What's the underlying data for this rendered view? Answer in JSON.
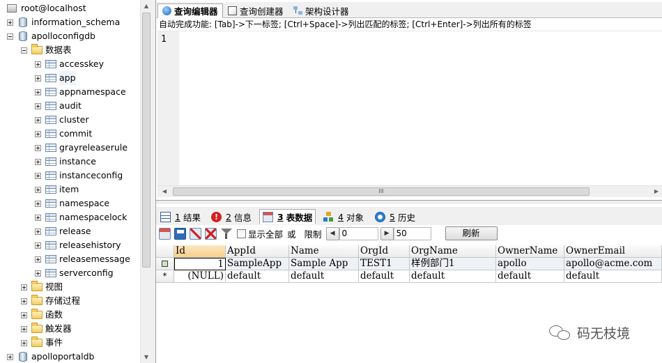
{
  "tree": {
    "items": [
      {
        "label": "root@localhost",
        "icon": "server-icon",
        "expander": "none"
      },
      {
        "label": "information_schema",
        "icon": "database-icon",
        "expander": "plus"
      },
      {
        "label": "apolloconfigdb",
        "icon": "database-icon",
        "expander": "minus"
      },
      {
        "label": "数据表",
        "icon": "folder-icon",
        "expander": "minus"
      },
      {
        "label": "accesskey",
        "icon": "table-icon",
        "expander": "plus"
      },
      {
        "label": "app",
        "icon": "table-icon",
        "expander": "plus",
        "selected": true
      },
      {
        "label": "appnamespace",
        "icon": "table-icon",
        "expander": "plus"
      },
      {
        "label": "audit",
        "icon": "table-icon",
        "expander": "plus"
      },
      {
        "label": "cluster",
        "icon": "table-icon",
        "expander": "plus"
      },
      {
        "label": "commit",
        "icon": "table-icon",
        "expander": "plus"
      },
      {
        "label": "grayreleaserule",
        "icon": "table-icon",
        "expander": "plus"
      },
      {
        "label": "instance",
        "icon": "table-icon",
        "expander": "plus"
      },
      {
        "label": "instanceconfig",
        "icon": "table-icon",
        "expander": "plus"
      },
      {
        "label": "item",
        "icon": "table-icon",
        "expander": "plus"
      },
      {
        "label": "namespace",
        "icon": "table-icon",
        "expander": "plus"
      },
      {
        "label": "namespacelock",
        "icon": "table-icon",
        "expander": "plus"
      },
      {
        "label": "release",
        "icon": "table-icon",
        "expander": "plus"
      },
      {
        "label": "releasehistory",
        "icon": "table-icon",
        "expander": "plus"
      },
      {
        "label": "releasemessage",
        "icon": "table-icon",
        "expander": "plus"
      },
      {
        "label": "serverconfig",
        "icon": "table-icon",
        "expander": "plus"
      },
      {
        "label": "视图",
        "icon": "folder-icon",
        "expander": "plus"
      },
      {
        "label": "存储过程",
        "icon": "folder-icon",
        "expander": "plus"
      },
      {
        "label": "函数",
        "icon": "folder-icon",
        "expander": "plus"
      },
      {
        "label": "触发器",
        "icon": "folder-icon",
        "expander": "plus"
      },
      {
        "label": "事件",
        "icon": "folder-icon",
        "expander": "plus"
      },
      {
        "label": "apolloportaldb",
        "icon": "database-icon",
        "expander": "plus"
      }
    ]
  },
  "query_tabs": [
    {
      "label": "查询编辑器",
      "icon": "query-editor-icon",
      "active": true
    },
    {
      "label": "查询创建器",
      "icon": "query-builder-icon",
      "active": false
    },
    {
      "label": "架构设计器",
      "icon": "schema-designer-icon",
      "active": false
    }
  ],
  "editor": {
    "hint": "自动完成功能: [Tab]->下一标签; [Ctrl+Space]->列出匹配的标签; [Ctrl+Enter]->列出所有的标签",
    "line_number": "1",
    "hscroll_grip": "III"
  },
  "result_tabs": [
    {
      "num": "1",
      "label": "结果",
      "icon": "result-icon",
      "active": false
    },
    {
      "num": "2",
      "label": "信息",
      "icon": "info-icon",
      "active": false
    },
    {
      "num": "3",
      "label": "表数据",
      "icon": "table-data-icon",
      "active": true
    },
    {
      "num": "4",
      "label": "对象",
      "icon": "objects-icon",
      "active": false
    },
    {
      "num": "5",
      "label": "历史",
      "icon": "history-icon",
      "active": false
    }
  ],
  "toolbar": {
    "show_all_label": "显示全部",
    "or_label": "或",
    "limit_label": "限制",
    "offset_value": "0",
    "count_value": "50",
    "refresh_label": "刷新",
    "prev_glyph": "◀",
    "next_glyph": "▶"
  },
  "grid": {
    "columns": [
      "Id",
      "AppId",
      "Name",
      "OrgId",
      "OrgName",
      "OwnerName",
      "OwnerEmail"
    ],
    "rows": [
      {
        "indicator": "",
        "cells": [
          "1",
          "SampleApp",
          "Sample App",
          "TEST1",
          "样例部门1",
          "apollo",
          "apollo@acme.com"
        ]
      },
      {
        "indicator": "*",
        "cells": [
          "(NULL)",
          "default",
          "default",
          "default",
          "default",
          "default",
          "default"
        ]
      }
    ]
  },
  "watermark": "码无枝境",
  "colors": {
    "active_header": "#f7d08a",
    "row_highlight": "#eef1f6",
    "info_icon": "#d32020"
  }
}
